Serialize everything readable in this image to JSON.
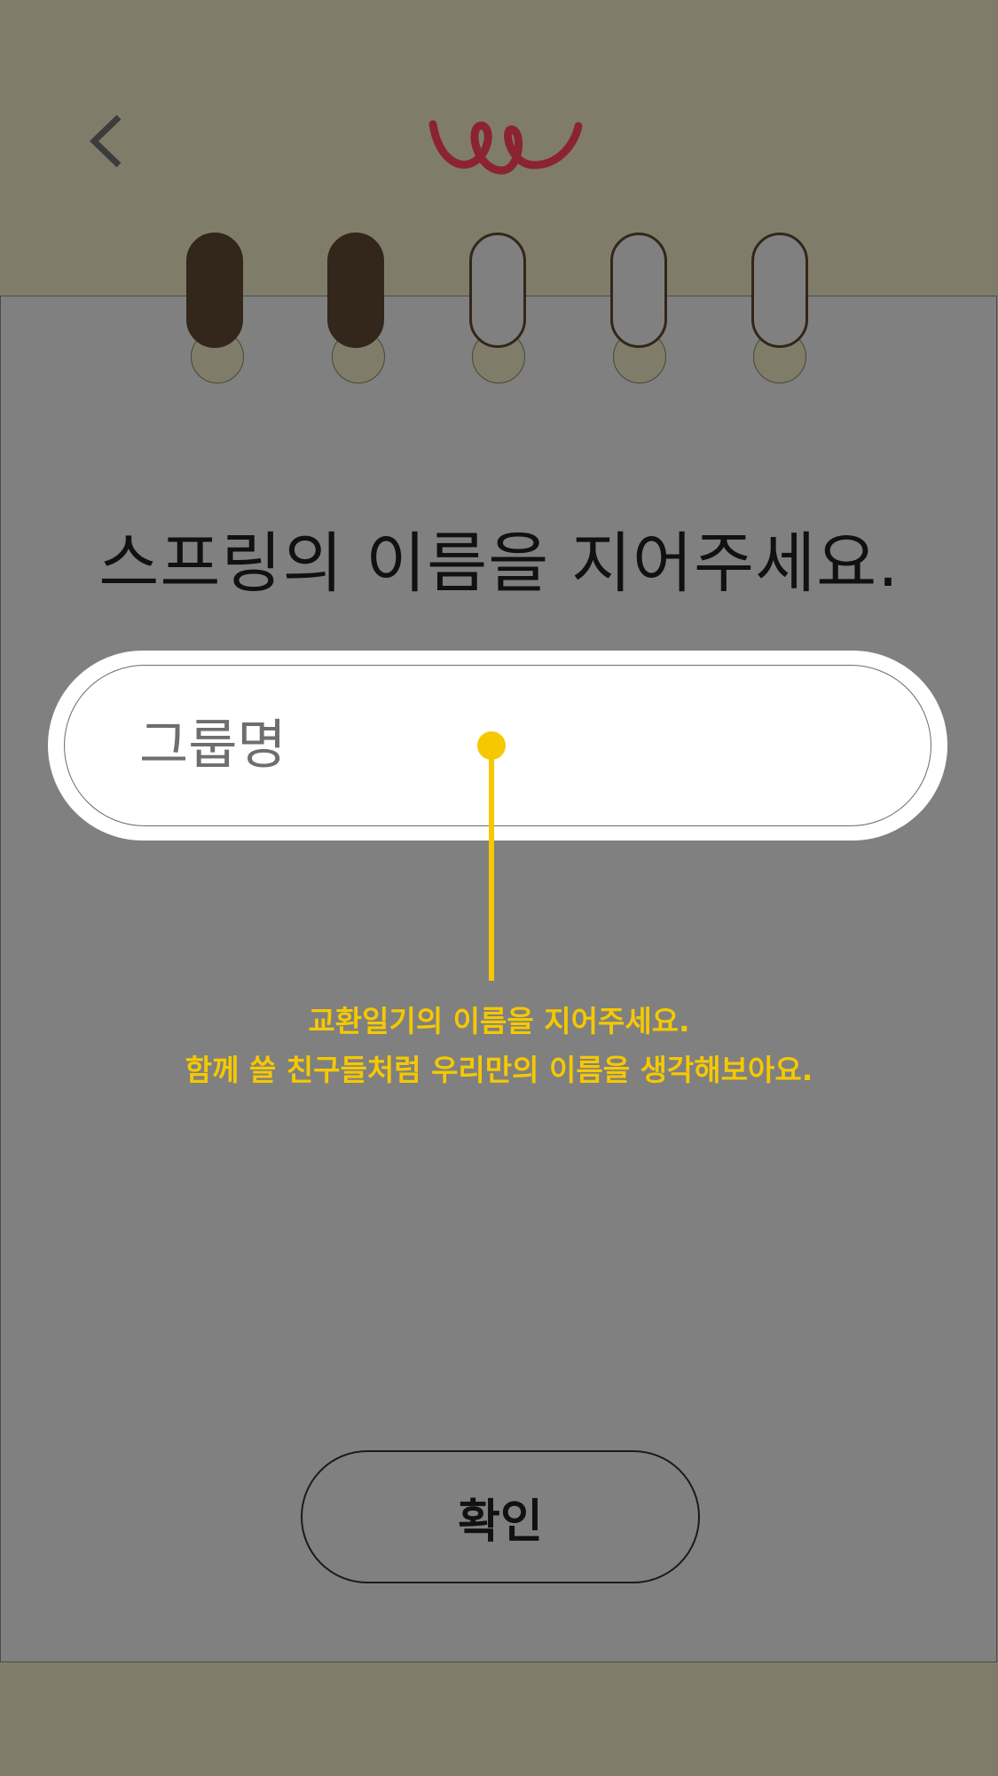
{
  "header": {
    "back_icon": "chevron-left-icon",
    "logo_icon": "spring-coil-logo-icon"
  },
  "progress": {
    "total_steps": 5,
    "completed_steps": 2
  },
  "main": {
    "title": "스프링의 이름을 지어주세요.",
    "input": {
      "placeholder": "그룹명",
      "value": ""
    },
    "tooltip": {
      "line1": "교환일기의 이름을 지어주세요.",
      "line2": "함께 쓸 친구들처럼 우리만의 이름을 생각해보아요."
    },
    "confirm_label": "확인"
  },
  "colors": {
    "background_olive": "#7f7d6a",
    "paper_gray": "#808080",
    "ring_dark": "#33261a",
    "logo_red": "#8b2430",
    "tooltip_yellow": "#f5c800"
  }
}
